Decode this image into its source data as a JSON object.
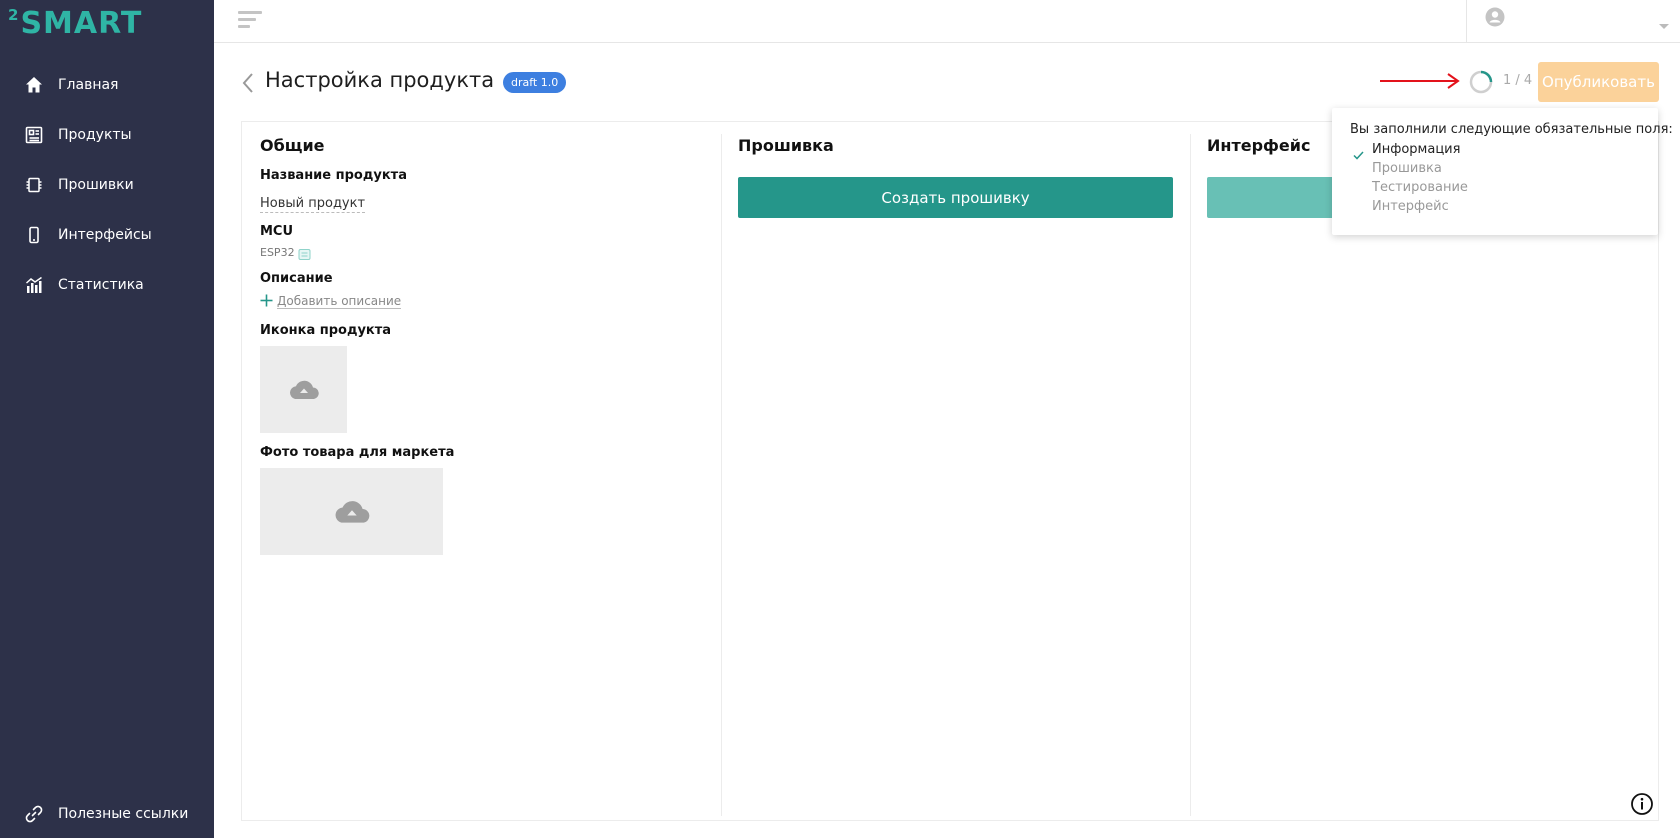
{
  "app": {
    "logo_sup": "2",
    "logo_text": "SMART"
  },
  "sidebar": {
    "items": [
      {
        "label": "Главная",
        "icon": "home-icon"
      },
      {
        "label": "Продукты",
        "icon": "products-icon"
      },
      {
        "label": "Прошивки",
        "icon": "firmware-chip-icon"
      },
      {
        "label": "Интерфейсы",
        "icon": "phone-icon"
      },
      {
        "label": "Статистика",
        "icon": "statistics-icon"
      }
    ],
    "bottom_item": {
      "label": "Полезные ссылки",
      "icon": "link-icon"
    }
  },
  "header": {
    "title": "Настройка продукта",
    "badge": "draft 1.0",
    "progress": {
      "current": 1,
      "total": 4,
      "text": "1 / 4"
    },
    "publish_label": "Опубликовать"
  },
  "general": {
    "title": "Общие",
    "product_name_label": "Название продукта",
    "product_name_value": "Новый продукт",
    "mcu_label": "MCU",
    "mcu_value": "ESP32",
    "description_label": "Описание",
    "add_description": "Добавить описание",
    "icon_label": "Иконка продукта",
    "photo_label": "Фото товара для маркета"
  },
  "firmware": {
    "title": "Прошивка",
    "create_label": "Создать прошивку"
  },
  "interface": {
    "title": "Интерфейс"
  },
  "tooltip": {
    "heading": "Вы заполнили следующие обязательные поля:",
    "items": [
      {
        "label": "Информация",
        "done": true
      },
      {
        "label": "Прошивка",
        "done": false
      },
      {
        "label": "Тестирование",
        "done": false
      },
      {
        "label": "Интерфейс",
        "done": false
      }
    ]
  },
  "colors": {
    "sidebar_bg": "#2d3149",
    "logo": "#2fb5a5",
    "badge": "#3d7fe0",
    "publish_disabled": "#fbd29a",
    "primary_green": "#25968a",
    "arrow_annotation": "#e3121b"
  }
}
